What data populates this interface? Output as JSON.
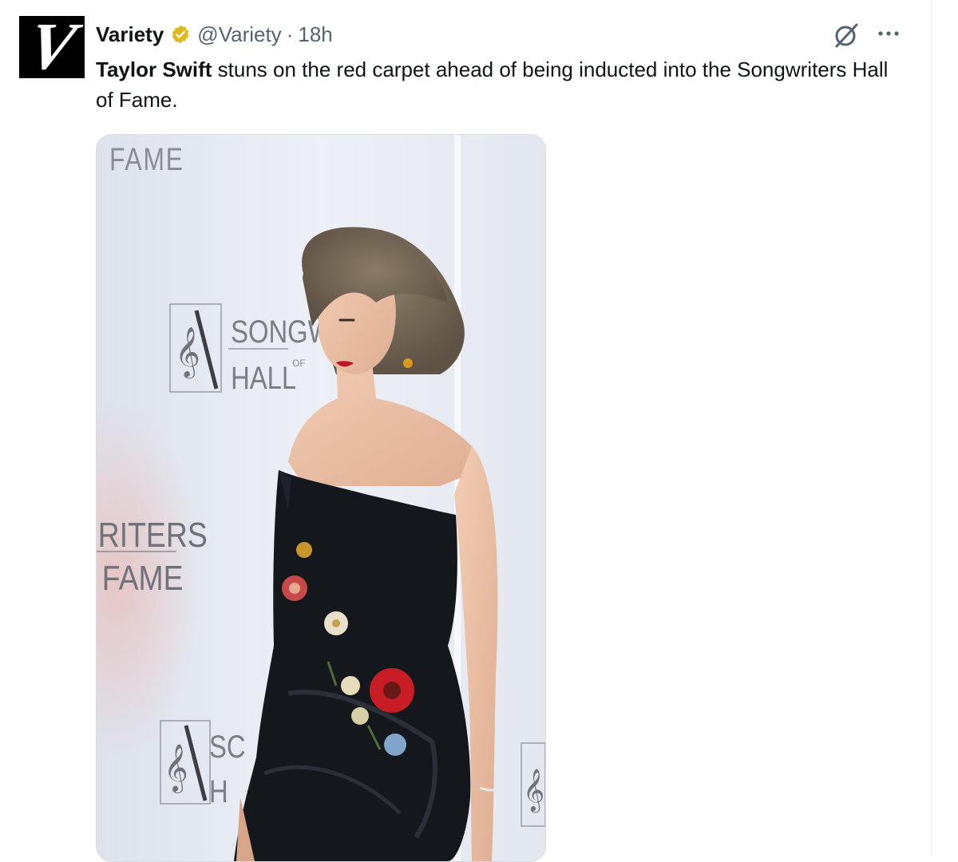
{
  "tweet": {
    "author_name": "Variety",
    "handle": "@Variety",
    "separator": "·",
    "time": "18h",
    "avatar_letter": "V",
    "text_bold": "Taylor Swift",
    "text_rest": " stuns on the red carpet ahead of being inducted into the Songwriters Hall of Fame.",
    "verified_color": "#e2b719"
  },
  "media": {
    "backdrop_texts": {
      "top": "FAME",
      "songw": "SONGW",
      "hall_of": "HALL",
      "of": "OF",
      "riters": "RITERS",
      "fame": "FAME",
      "bottom_s": "SC",
      "bottom_h": "H"
    },
    "icons": [
      "grok-icon",
      "more-icon",
      "verified-badge-icon",
      "treble-clef-icon"
    ]
  }
}
